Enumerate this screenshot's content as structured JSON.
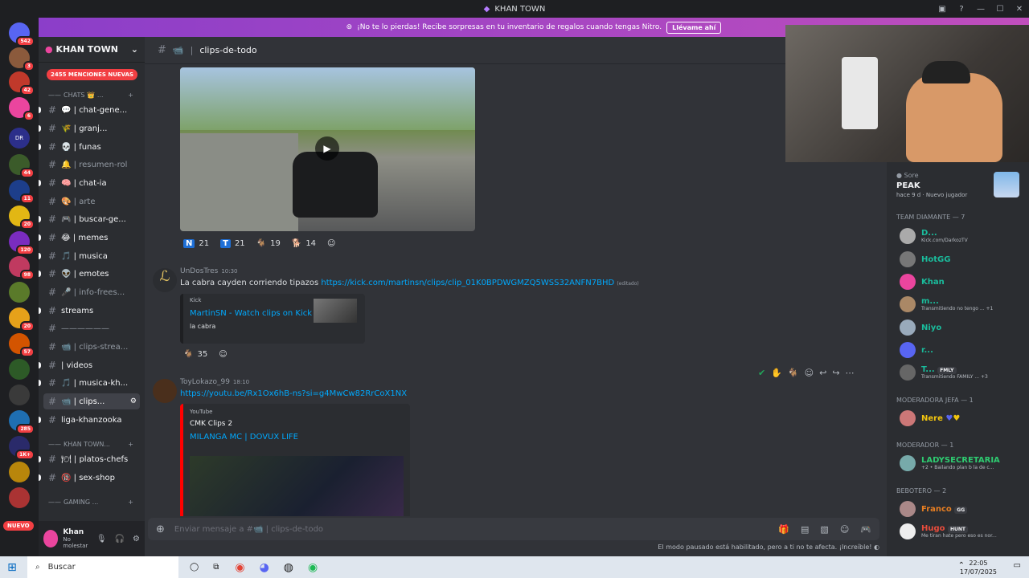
{
  "window": {
    "title": "KHAN TOWN"
  },
  "nitro": {
    "text": "¡No te lo pierdas! Recibe sorpresas en tu inventario de regalos cuando tengas Nitro.",
    "button": "Llévame ahí"
  },
  "servers": {
    "badges": [
      "542",
      "3",
      "42",
      "6",
      "44",
      "11",
      "20",
      "120",
      "98",
      "20",
      "57",
      "285",
      "1K+"
    ],
    "dr_label": "DR",
    "nuevo": "NUEVO"
  },
  "guild": {
    "name": "KHAN TOWN",
    "mentions": "2455 MENCIONES NUEVAS",
    "cat_chats": "CHATS",
    "cat_khan": "KHAN TOWN...",
    "cat_gaming": "GAMING ...",
    "channels": [
      {
        "name": "chat-gene...",
        "emoji": "💬"
      },
      {
        "name": "granj...",
        "emoji": "🌾"
      },
      {
        "name": "funas",
        "emoji": "💀"
      },
      {
        "name": "resumen-rol",
        "emoji": "🔔"
      },
      {
        "name": "chat-ia",
        "emoji": "🧠"
      },
      {
        "name": "arte",
        "emoji": "🎨"
      },
      {
        "name": "buscar-ge...",
        "emoji": "🎮"
      },
      {
        "name": "memes",
        "emoji": "😂"
      },
      {
        "name": "musica",
        "emoji": "🎵"
      },
      {
        "name": "emotes",
        "emoji": "👽"
      },
      {
        "name": "info-frees...",
        "emoji": "🎤"
      },
      {
        "name": "streams",
        "emoji": ""
      },
      {
        "name": "——————",
        "emoji": ""
      },
      {
        "name": "clips-strea...",
        "emoji": "📹"
      },
      {
        "name": "videos",
        "emoji": "|"
      },
      {
        "name": "musica-kh...",
        "emoji": "🎵"
      },
      {
        "name": "clips...",
        "emoji": "📹"
      },
      {
        "name": "liga-khanzooka",
        "emoji": ""
      },
      {
        "name": "platos-chefs",
        "emoji": "🍽"
      },
      {
        "name": "sex-shop",
        "emoji": "🔞"
      }
    ]
  },
  "user": {
    "name": "Khan",
    "status": "No molestar"
  },
  "channel": {
    "name": "clips-de-todo"
  },
  "messages": {
    "reactions1": [
      {
        "icon": "N",
        "count": "21"
      },
      {
        "icon": "T",
        "count": "21"
      },
      {
        "icon": "🐐",
        "count": "19"
      },
      {
        "icon": "🐕",
        "count": "14"
      }
    ],
    "m1": {
      "author": "UnDosTres",
      "time": "10:30",
      "text": "La cabra cayden corriendo tipazos",
      "link": "https://kick.com/martinsn/clips/clip_01K0BPDWGMZQ5WSS32ANFN7BHD",
      "edited": "(editado)",
      "embed": {
        "provider": "Kick",
        "title": "MartinSN - Watch clips on Kick",
        "desc": "la cabra"
      },
      "reaction": "35"
    },
    "m2": {
      "author": "ToyLokazo_99",
      "time": "18:10",
      "link": "https://youtu.be/Rx1Ox6hB-ns?si=g4MwCw82RrCoX1NX",
      "embed": {
        "provider": "YouTube",
        "author": "CMK Clips 2",
        "title": "MILANGA MC | DOVUX LIFE"
      }
    }
  },
  "composer": {
    "placeholder": "Enviar mensaje a #📹 | clips-de-todo"
  },
  "pause_notice": "El modo pausado está habilitado, pero a ti no te afecta. ¡Increíble!",
  "members": {
    "activity_user": "Sore",
    "activity_game": "PEAK",
    "activity_time": "hace 9 d",
    "activity_tag": "Nuevo jugador",
    "groups": [
      {
        "label": "TEAM DIAMANTE — 7"
      },
      {
        "label": "MODERADORA JEFA — 1"
      },
      {
        "label": "MODERADOR — 1"
      },
      {
        "label": "BEBOTERO — 2"
      }
    ],
    "list": [
      {
        "name": "D...",
        "status": "Kick.com/DarkozTV",
        "color": "#1abc9c"
      },
      {
        "name": "HotGG",
        "status": "",
        "color": "#1abc9c"
      },
      {
        "name": "Khan",
        "status": "",
        "color": "#1abc9c"
      },
      {
        "name": "m...",
        "status": "Transmitiendo no tengo ... +1",
        "color": "#1abc9c"
      },
      {
        "name": "Niyo",
        "status": "",
        "color": "#1abc9c"
      },
      {
        "name": "r...",
        "status": "",
        "color": "#1abc9c"
      },
      {
        "name": "T...",
        "status": "Transmitiendo FAMILY ... +3",
        "badge": "FMLY",
        "color": "#1abc9c"
      },
      {
        "name": "Nere",
        "status": "",
        "color": "#f1c40f"
      },
      {
        "name": "LADYSECRETARIA",
        "status": "+2 • Bailando plan b la de c...",
        "color": "#2ecc71"
      },
      {
        "name": "Franco",
        "status": "",
        "badge": "GG",
        "color": "#e67e22"
      },
      {
        "name": "Hugo",
        "status": "Me tiran hate pero eso es nor...",
        "badge": "HUNT",
        "color": "#e74c3c"
      }
    ]
  },
  "taskbar": {
    "search": "Buscar",
    "time": "22:05",
    "date": "17/07/2025"
  },
  "colors": {
    "accent": "#5865f2",
    "danger": "#f23f43",
    "link": "#00a8fc"
  }
}
